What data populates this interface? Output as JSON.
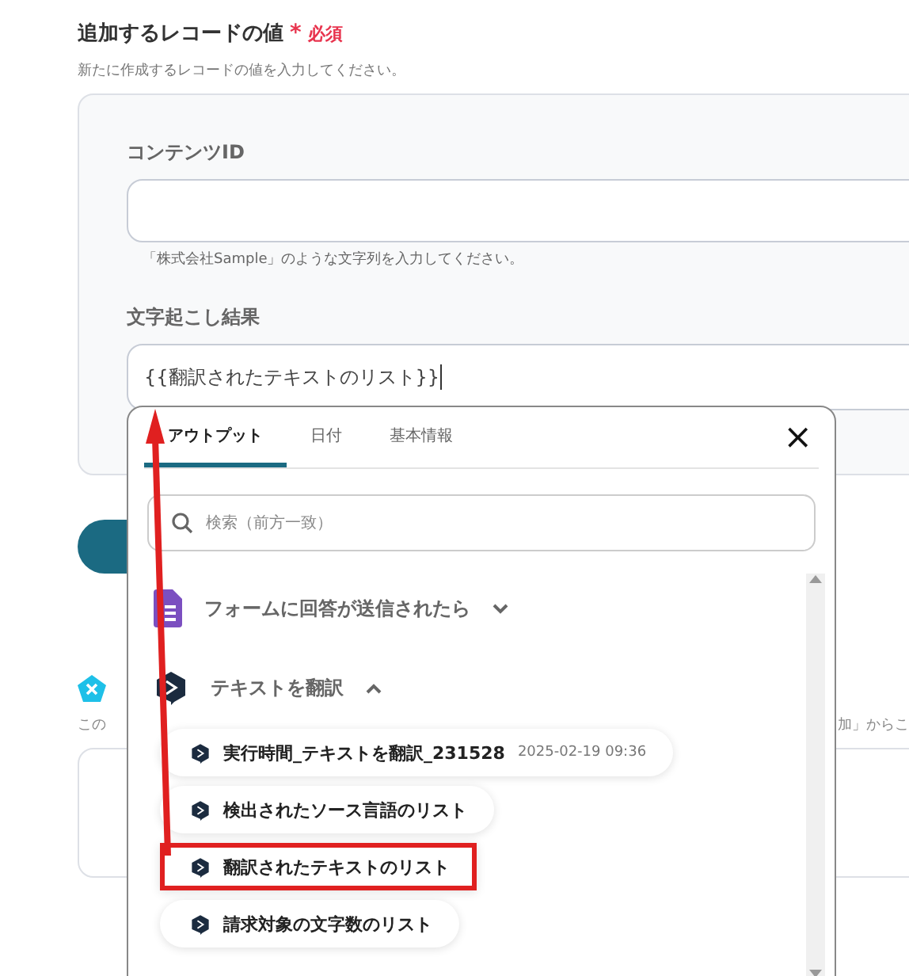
{
  "section": {
    "title": "追加するレコードの値",
    "required_mark": "*",
    "required_label": "必須",
    "description": "新たに作成するレコードの値を入力してください。"
  },
  "fields": [
    {
      "label": "コンテンツID",
      "hint": "「株式会社Sample」のような文字列を入力してください。"
    },
    {
      "label": "文字起こし結果",
      "value": "{{翻訳されたテキストのリスト}}"
    }
  ],
  "background": {
    "note_left": "この",
    "note_right": "加」からこ"
  },
  "popup": {
    "tabs": [
      {
        "label": "アウトプット",
        "selected": true
      },
      {
        "label": "日付",
        "selected": false
      },
      {
        "label": "基本情報",
        "selected": false
      }
    ],
    "close": "×",
    "search": {
      "placeholder": "検索（前方一致）"
    },
    "groups": [
      {
        "kind": "form",
        "title": "フォームに回答が送信されたら",
        "expanded": false
      },
      {
        "kind": "translate",
        "title": "テキストを翻訳",
        "expanded": true,
        "items": [
          {
            "label": "実行時間_テキストを翻訳_231528",
            "meta": "2025-02-19 09:36",
            "highlighted": false
          },
          {
            "label": "検出されたソース言語のリスト",
            "highlighted": false
          },
          {
            "label": "翻訳されたテキストのリスト",
            "highlighted": true
          },
          {
            "label": "請求対象の文字数のリスト",
            "highlighted": false
          }
        ]
      }
    ]
  }
}
